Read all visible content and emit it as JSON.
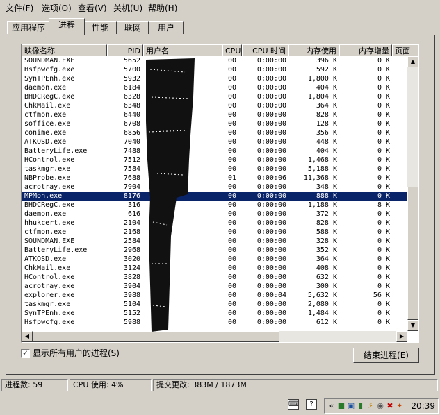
{
  "menu": [
    "文件(F)",
    "选项(O)",
    "查看(V)",
    "关机(U)",
    "帮助(H)"
  ],
  "tabs": [
    "应用程序",
    "进程",
    "性能",
    "联网",
    "用户"
  ],
  "columns": [
    "映像名称",
    "PID",
    "用户名",
    "CPU",
    "CPU 时间",
    "内存使用",
    "内存增量",
    "页面"
  ],
  "processes": [
    {
      "name": "SOUNDMAN.EXE",
      "pid": "5652",
      "cpu": "00",
      "time": "0:00:00",
      "mem": "396 K",
      "delta": "0 K"
    },
    {
      "name": "Hsfpwcfg.exe",
      "pid": "5700",
      "cpu": "00",
      "time": "0:00:00",
      "mem": "592 K",
      "delta": "0 K"
    },
    {
      "name": "SynTPEnh.exe",
      "pid": "5932",
      "cpu": "00",
      "time": "0:00:00",
      "mem": "1,800 K",
      "delta": "0 K"
    },
    {
      "name": "daemon.exe",
      "pid": "6184",
      "cpu": "00",
      "time": "0:00:00",
      "mem": "404 K",
      "delta": "0 K"
    },
    {
      "name": "BHDCRegC.exe",
      "pid": "6328",
      "cpu": "00",
      "time": "0:00:00",
      "mem": "1,804 K",
      "delta": "0 K"
    },
    {
      "name": "ChkMail.exe",
      "pid": "6348",
      "cpu": "00",
      "time": "0:00:00",
      "mem": "364 K",
      "delta": "0 K"
    },
    {
      "name": "ctfmon.exe",
      "pid": "6440",
      "cpu": "00",
      "time": "0:00:00",
      "mem": "828 K",
      "delta": "0 K"
    },
    {
      "name": "soffice.exe",
      "pid": "6708",
      "cpu": "00",
      "time": "0:00:00",
      "mem": "128 K",
      "delta": "0 K"
    },
    {
      "name": "conime.exe",
      "pid": "6856",
      "cpu": "00",
      "time": "0:00:00",
      "mem": "356 K",
      "delta": "0 K"
    },
    {
      "name": "ATKOSD.exe",
      "pid": "7040",
      "cpu": "00",
      "time": "0:00:00",
      "mem": "448 K",
      "delta": "0 K"
    },
    {
      "name": "BatteryLife.exe",
      "pid": "7488",
      "cpu": "00",
      "time": "0:00:00",
      "mem": "404 K",
      "delta": "0 K"
    },
    {
      "name": "HControl.exe",
      "pid": "7512",
      "cpu": "00",
      "time": "0:00:00",
      "mem": "1,468 K",
      "delta": "0 K"
    },
    {
      "name": "taskmgr.exe",
      "pid": "7584",
      "cpu": "00",
      "time": "0:00:00",
      "mem": "5,188 K",
      "delta": "0 K"
    },
    {
      "name": "NBProbe.exe",
      "pid": "7688",
      "cpu": "01",
      "time": "0:00:06",
      "mem": "11,368 K",
      "delta": "0 K"
    },
    {
      "name": "acrotray.exe",
      "pid": "7904",
      "cpu": "00",
      "time": "0:00:00",
      "mem": "348 K",
      "delta": "0 K"
    },
    {
      "name": "MPMon.exe",
      "pid": "8176",
      "cpu": "00",
      "time": "0:00:00",
      "mem": "888 K",
      "delta": "0 K",
      "selected": true
    },
    {
      "name": "BHDCRegC.exe",
      "pid": "316",
      "cpu": "00",
      "time": "0:00:00",
      "mem": "1,188 K",
      "delta": "8 K"
    },
    {
      "name": "daemon.exe",
      "pid": "616",
      "cpu": "00",
      "time": "0:00:00",
      "mem": "372 K",
      "delta": "0 K"
    },
    {
      "name": "hhukcert.exe",
      "pid": "2104",
      "cpu": "00",
      "time": "0:00:00",
      "mem": "828 K",
      "delta": "0 K"
    },
    {
      "name": "ctfmon.exe",
      "pid": "2168",
      "cpu": "00",
      "time": "0:00:00",
      "mem": "588 K",
      "delta": "0 K"
    },
    {
      "name": "SOUNDMAN.EXE",
      "pid": "2584",
      "cpu": "00",
      "time": "0:00:00",
      "mem": "328 K",
      "delta": "0 K"
    },
    {
      "name": "BatteryLife.exe",
      "pid": "2968",
      "cpu": "00",
      "time": "0:00:00",
      "mem": "352 K",
      "delta": "0 K"
    },
    {
      "name": "ATKOSD.exe",
      "pid": "3020",
      "cpu": "00",
      "time": "0:00:00",
      "mem": "364 K",
      "delta": "0 K"
    },
    {
      "name": "ChkMail.exe",
      "pid": "3124",
      "cpu": "00",
      "time": "0:00:00",
      "mem": "408 K",
      "delta": "0 K"
    },
    {
      "name": "HControl.exe",
      "pid": "3828",
      "cpu": "00",
      "time": "0:00:00",
      "mem": "632 K",
      "delta": "0 K"
    },
    {
      "name": "acrotray.exe",
      "pid": "3904",
      "cpu": "00",
      "time": "0:00:00",
      "mem": "300 K",
      "delta": "0 K"
    },
    {
      "name": "explorer.exe",
      "pid": "3988",
      "cpu": "00",
      "time": "0:00:04",
      "mem": "5,632 K",
      "delta": "56 K"
    },
    {
      "name": "taskmgr.exe",
      "pid": "5104",
      "cpu": "00",
      "time": "0:00:00",
      "mem": "2,080 K",
      "delta": "0 K"
    },
    {
      "name": "SynTPEnh.exe",
      "pid": "5152",
      "cpu": "00",
      "time": "0:00:00",
      "mem": "1,484 K",
      "delta": "0 K"
    },
    {
      "name": "Hsfpwcfg.exe",
      "pid": "5988",
      "cpu": "00",
      "time": "0:00:00",
      "mem": "612 K",
      "delta": "0 K"
    }
  ],
  "show_all_label": "显示所有用户的进程(S)",
  "show_all_checked": true,
  "end_process_label": "结束进程(E)",
  "status": {
    "processes": "进程数: 59",
    "cpu": "CPU 使用: 4%",
    "commit": "提交更改: 383M / 1873M"
  },
  "clock": "20:39",
  "colors": {
    "selection": "#0a246a",
    "face": "#d4d0c8"
  }
}
